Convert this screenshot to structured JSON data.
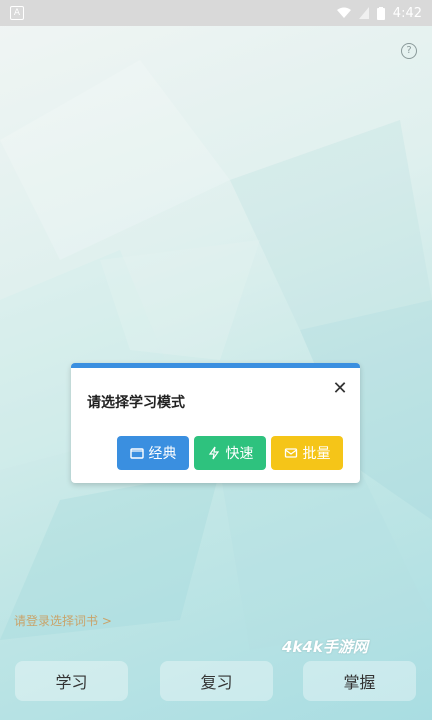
{
  "status_bar": {
    "time": "4:42"
  },
  "help": {
    "icon": "help-circle-icon",
    "glyph": "?"
  },
  "dialog": {
    "title": "请选择学习模式",
    "close_glyph": "✕",
    "buttons": [
      {
        "label": "经典",
        "icon": "folder-icon",
        "color": "#3a8fe0"
      },
      {
        "label": "快速",
        "icon": "lightning-icon",
        "color": "#2ec27e"
      },
      {
        "label": "批量",
        "icon": "layers-icon",
        "color": "#f5c518"
      }
    ]
  },
  "login_prompt": "请登录选择词书 >",
  "watermark": "4k4k手游网",
  "tabs": [
    {
      "label": "学习"
    },
    {
      "label": "复习"
    },
    {
      "label": "掌握"
    }
  ]
}
